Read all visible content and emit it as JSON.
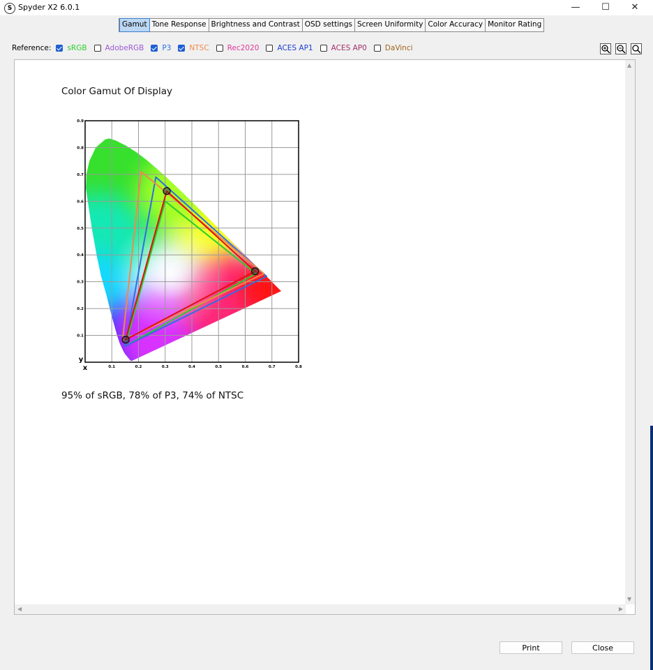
{
  "window": {
    "title": "Spyder X2 6.0.1",
    "app_icon_glyph": "S",
    "minimize_glyph": "—",
    "maximize_glyph": "☐",
    "close_glyph": "✕"
  },
  "tabs": [
    {
      "label": "Gamut",
      "active": true
    },
    {
      "label": "Tone Response",
      "active": false
    },
    {
      "label": "Brightness and Contrast",
      "active": false
    },
    {
      "label": "OSD settings",
      "active": false
    },
    {
      "label": "Screen Uniformity",
      "active": false
    },
    {
      "label": "Color Accuracy",
      "active": false
    },
    {
      "label": "Monitor Rating",
      "active": false
    }
  ],
  "reference": {
    "label": "Reference:",
    "items": [
      {
        "label": "sRGB",
        "checked": true,
        "color": "#2ecc2e"
      },
      {
        "label": "AdobeRGB",
        "checked": false,
        "color": "#9b59d6"
      },
      {
        "label": "P3",
        "checked": true,
        "color": "#2f6fe0"
      },
      {
        "label": "NTSC",
        "checked": true,
        "color": "#f08a4b"
      },
      {
        "label": "Rec2020",
        "checked": false,
        "color": "#e0399a"
      },
      {
        "label": "ACES AP1",
        "checked": false,
        "color": "#1c3fd1"
      },
      {
        "label": "ACES AP0",
        "checked": false,
        "color": "#a0306a"
      },
      {
        "label": "DaVinci",
        "checked": false,
        "color": "#a0631e"
      }
    ]
  },
  "zoom": {
    "zoom_in_icon": "zoom-in-icon",
    "zoom_out_icon": "zoom-out-icon",
    "zoom_fit_icon": "zoom-fit-icon"
  },
  "content": {
    "title": "Color Gamut Of Display",
    "summary": "95% of sRGB, 78% of P3, 74% of NTSC"
  },
  "chart_data": {
    "type": "scatter",
    "title": "",
    "xlabel": "x",
    "ylabel": "y",
    "xlim": [
      0,
      0.8
    ],
    "ylim": [
      0,
      0.9
    ],
    "x_ticks": [
      "0.1",
      "0.2",
      "0.3",
      "0.4",
      "0.5",
      "0.6",
      "0.7",
      "0.8"
    ],
    "y_ticks": [
      "0.1",
      "0.2",
      "0.3",
      "0.4",
      "0.5",
      "0.6",
      "0.7",
      "0.8",
      "0.9"
    ],
    "grid": true,
    "locus": [
      [
        0.175,
        0.005
      ],
      [
        0.172,
        0.005
      ],
      [
        0.168,
        0.008
      ],
      [
        0.161,
        0.017
      ],
      [
        0.15,
        0.03
      ],
      [
        0.144,
        0.04
      ],
      [
        0.13,
        0.07
      ],
      [
        0.12,
        0.1
      ],
      [
        0.1,
        0.17
      ],
      [
        0.08,
        0.25
      ],
      [
        0.06,
        0.32
      ],
      [
        0.045,
        0.39
      ],
      [
        0.025,
        0.5
      ],
      [
        0.01,
        0.6
      ],
      [
        0.003,
        0.65
      ],
      [
        0.005,
        0.7
      ],
      [
        0.016,
        0.75
      ],
      [
        0.04,
        0.8
      ],
      [
        0.075,
        0.83
      ],
      [
        0.09,
        0.834
      ],
      [
        0.115,
        0.826
      ],
      [
        0.155,
        0.806
      ],
      [
        0.193,
        0.782
      ],
      [
        0.23,
        0.754
      ],
      [
        0.266,
        0.724
      ],
      [
        0.302,
        0.692
      ],
      [
        0.374,
        0.624
      ],
      [
        0.444,
        0.555
      ],
      [
        0.512,
        0.487
      ],
      [
        0.576,
        0.424
      ],
      [
        0.627,
        0.372
      ],
      [
        0.665,
        0.334
      ],
      [
        0.692,
        0.308
      ],
      [
        0.715,
        0.284
      ],
      [
        0.735,
        0.265
      ]
    ],
    "series": [
      {
        "name": "sRGB",
        "color": "#2ecc2e",
        "points": [
          [
            0.64,
            0.33
          ],
          [
            0.3,
            0.6
          ],
          [
            0.15,
            0.06
          ]
        ]
      },
      {
        "name": "P3",
        "color": "#2f6fe0",
        "points": [
          [
            0.68,
            0.32
          ],
          [
            0.265,
            0.69
          ],
          [
            0.15,
            0.06
          ]
        ]
      },
      {
        "name": "NTSC",
        "color": "#f08a4b",
        "points": [
          [
            0.67,
            0.33
          ],
          [
            0.21,
            0.71
          ],
          [
            0.14,
            0.08
          ]
        ]
      },
      {
        "name": "Display",
        "color": "#e01010",
        "points": [
          [
            0.637,
            0.339
          ],
          [
            0.306,
            0.638
          ],
          [
            0.152,
            0.084
          ]
        ]
      }
    ],
    "markers": [
      [
        0.637,
        0.339
      ],
      [
        0.306,
        0.638
      ],
      [
        0.152,
        0.084
      ]
    ]
  },
  "buttons": {
    "print": "Print",
    "close": "Close"
  }
}
